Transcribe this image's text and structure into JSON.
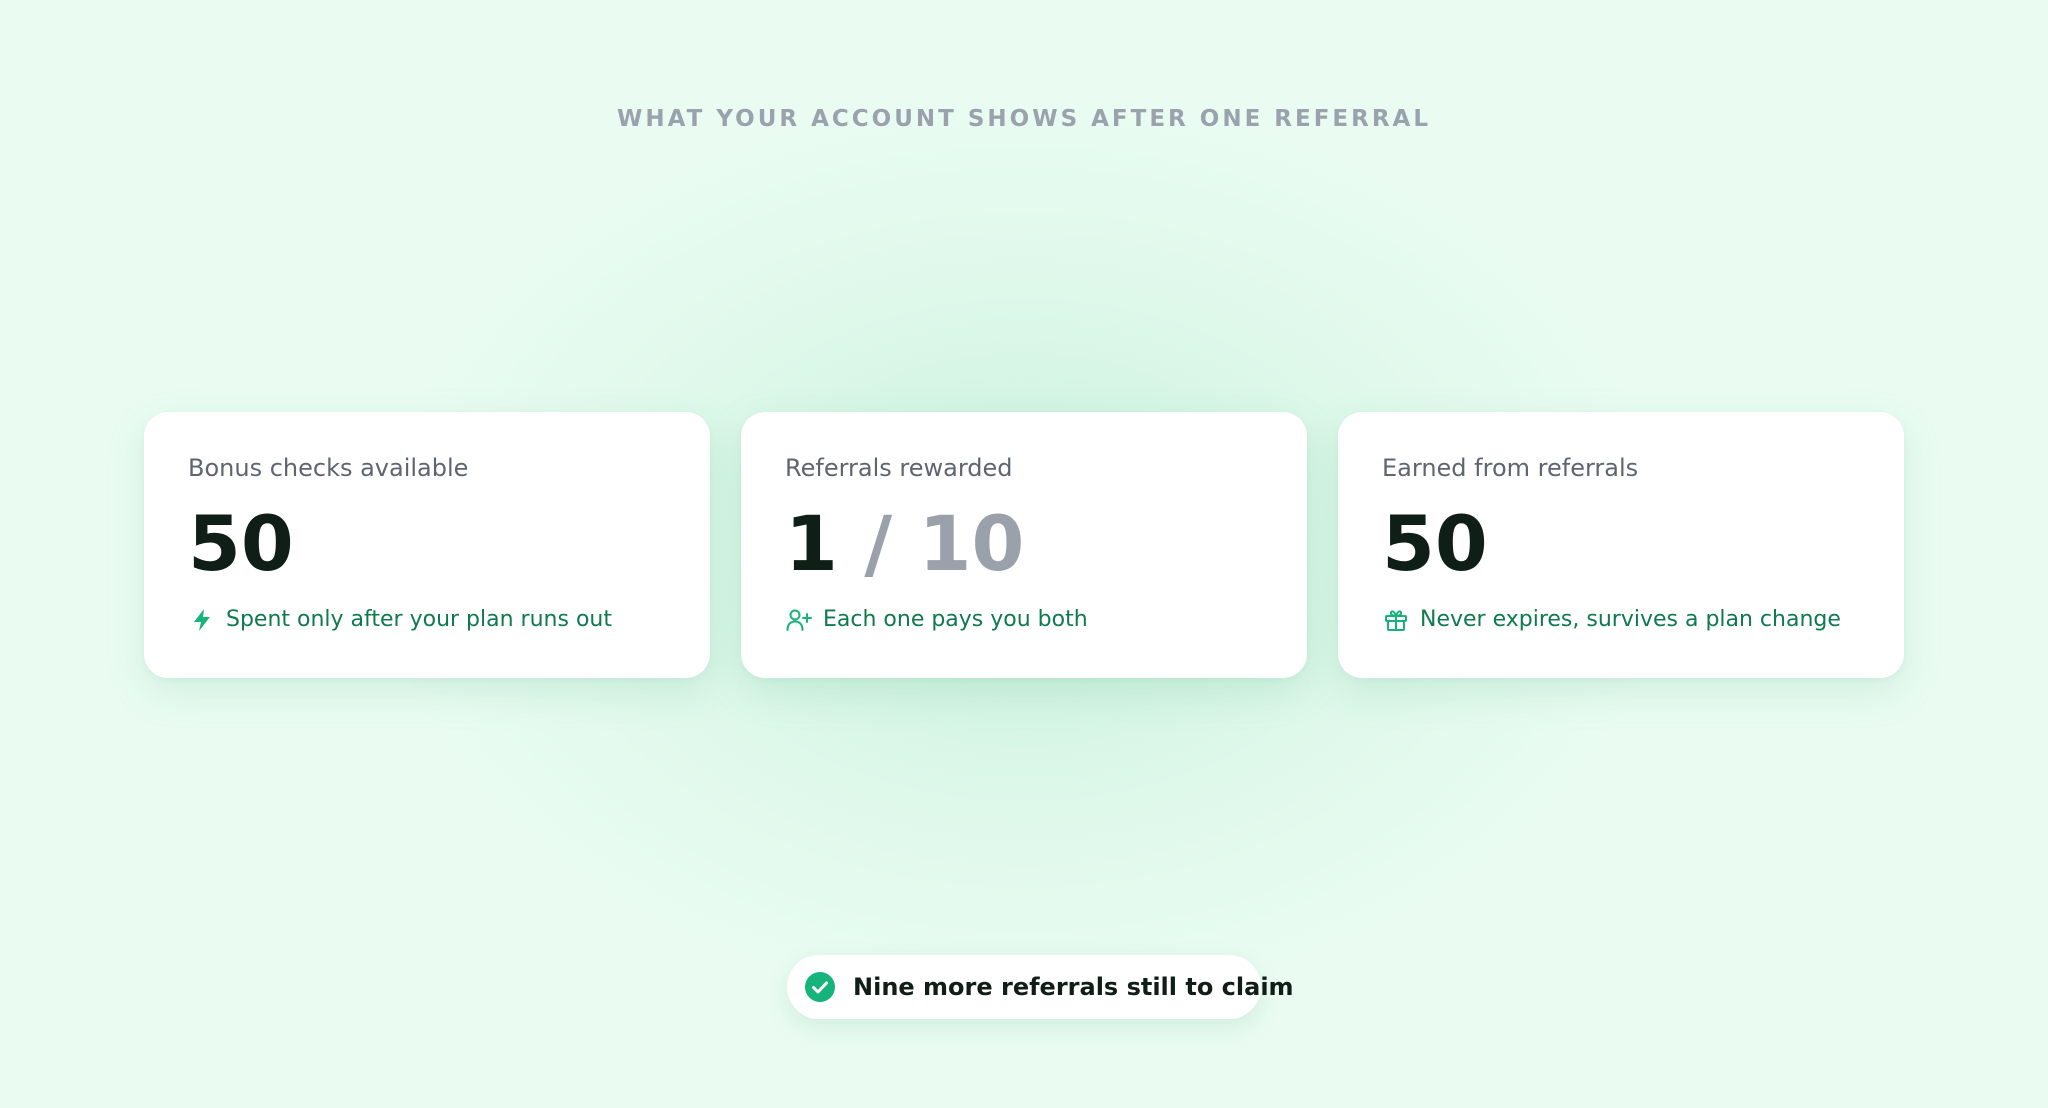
{
  "heading": "WHAT YOUR ACCOUNT SHOWS AFTER ONE REFERRAL",
  "colors": {
    "background": "#eafcf2",
    "accent": "#0f7a4e",
    "icon_green": "#16b37a",
    "value_dark": "#0f1f18",
    "muted": "#9ba1ab"
  },
  "cards": [
    {
      "label": "Bonus checks available",
      "value": "50",
      "note": "Spent only after your plan runs out",
      "icon": "lightning-icon"
    },
    {
      "label": "Referrals rewarded",
      "value_main": "1",
      "value_rest": " / 10",
      "note": "Each one pays you both",
      "icon": "user-plus-icon"
    },
    {
      "label": "Earned from referrals",
      "value": "50",
      "note": "Never expires, survives a plan change",
      "icon": "gift-icon"
    }
  ],
  "status": {
    "text": "Nine more referrals still to claim",
    "icon": "check-circle-icon"
  }
}
